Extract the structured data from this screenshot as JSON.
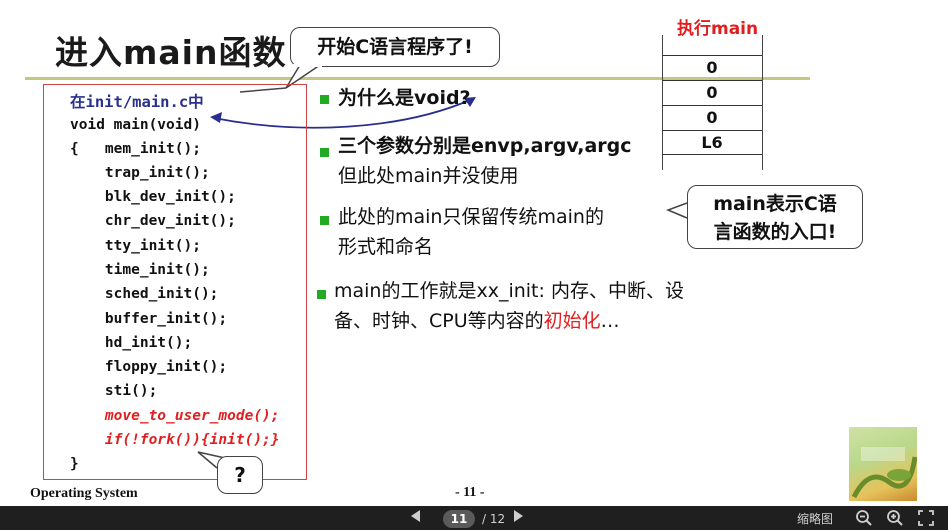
{
  "slide": {
    "title": "进入main函数",
    "callout_top": "开始C语言程序了!",
    "callout_right_line1": "main表示C语",
    "callout_right_line2": "言函数的入口!",
    "callout_question": "?"
  },
  "code": {
    "header": "在init/main.c中",
    "lines": [
      "void main(void)",
      "{   mem_init();",
      "    trap_init();",
      "    blk_dev_init();",
      "    chr_dev_init();",
      "    tty_init();",
      "    time_init();",
      "    sched_init();",
      "    buffer_init();",
      "    hd_init();",
      "    floppy_init();",
      "    sti();"
    ],
    "red_lines": [
      "    move_to_user_mode();",
      "    if(!fork()){init();}"
    ],
    "closing": "}"
  },
  "bullets": {
    "b1": "为什么是void?",
    "b2_line1": "三个参数分别是envp,argv,argc",
    "b2_line2": "但此处main并没使用",
    "b3_line1": "此处的main只保留传统main的",
    "b3_line2": "形式和命名",
    "b4_line1": "main的工作就是xx_init: 内存、中断、设",
    "b4_line2_prefix": "备、时钟、CPU等内容的",
    "b4_line2_red": "初始化",
    "b4_line2_suffix": "…"
  },
  "stack": {
    "caption": "执行main",
    "cells": [
      "0",
      "0",
      "0",
      "L6"
    ]
  },
  "footer": {
    "course": "Operating System",
    "page": "- 11 -"
  },
  "viewer": {
    "current_page": "11",
    "total": "/ 12",
    "thumbnails_label": "缩略图"
  },
  "icons": {
    "prev": "triangle-left-icon",
    "next": "triangle-right-icon",
    "zoom_out": "zoom-out-icon",
    "zoom_in": "zoom-in-icon",
    "fullscreen": "fullscreen-icon"
  },
  "colors": {
    "accent_red": "#e02020",
    "bullet_green": "#22aa22",
    "title_rule": "#c7c77e",
    "arrow_blue": "#2b2f8c"
  }
}
